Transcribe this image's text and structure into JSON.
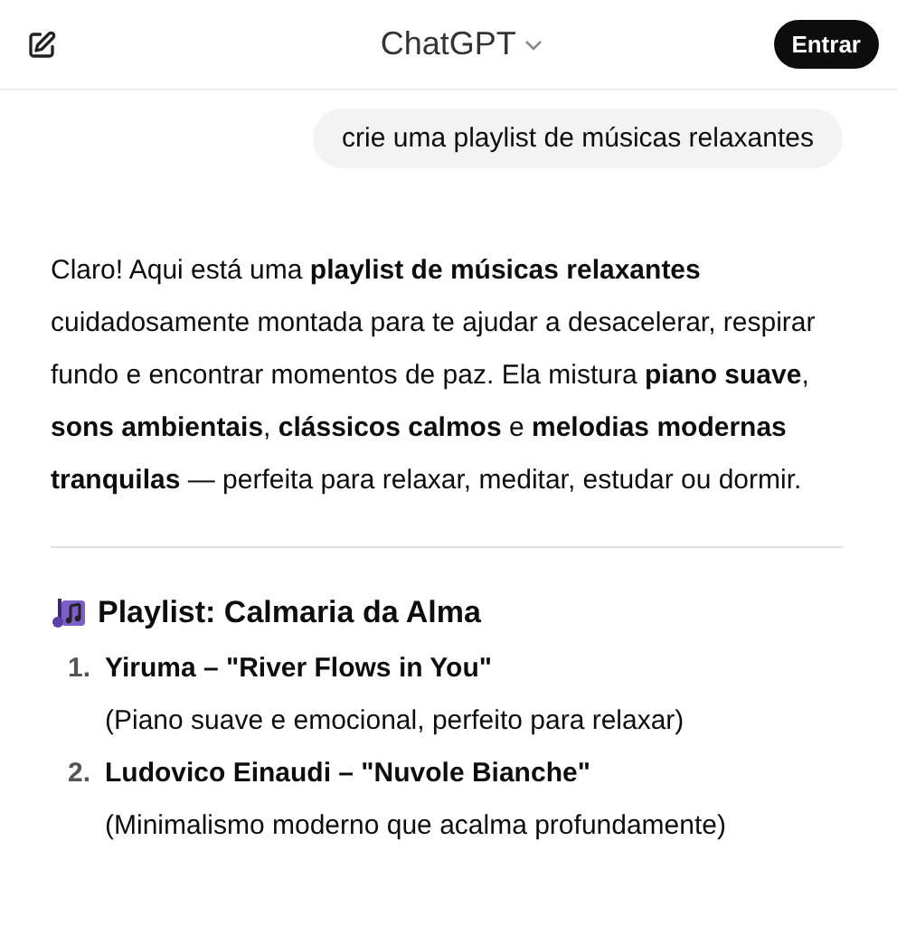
{
  "header": {
    "title": "ChatGPT",
    "login_button": "Entrar"
  },
  "user_message": "crie uma playlist de músicas relaxantes",
  "assistant": {
    "intro": "Claro! Aqui está uma **playlist de músicas relaxantes** cuidadosamente montada para te ajudar a desacelerar, respirar fundo e encontrar momentos de paz. Ela mistura **piano suave**, **sons ambientais**, **clássicos calmos** e **melodias modernas tranquilas** — perfeita para relaxar, meditar, estudar ou dormir.",
    "playlist_title": "Playlist: Calmaria da Alma",
    "tracks": [
      {
        "number": "1.",
        "title": "Yiruma – \"River Flows in You\"",
        "note": "(Piano suave e emocional, perfeito para relaxar)"
      },
      {
        "number": "2.",
        "title": "Ludovico Einaudi – \"Nuvole Bianche\"",
        "note": "(Minimalismo moderno que acalma profundamente)"
      }
    ]
  }
}
